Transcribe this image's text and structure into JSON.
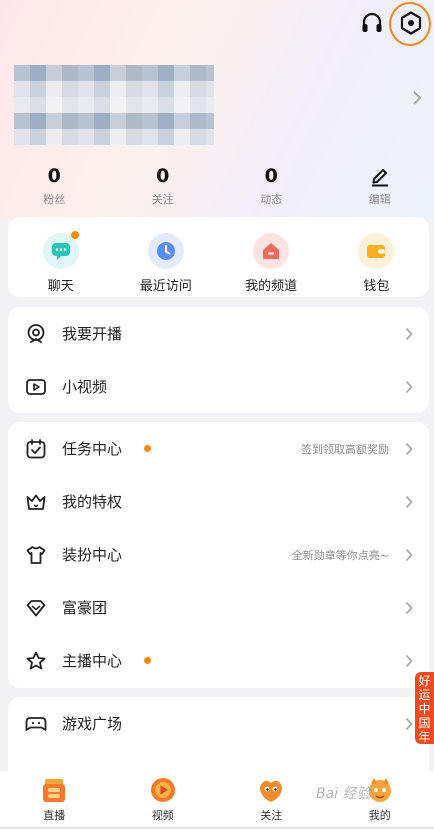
{
  "stats": [
    {
      "value": "0",
      "label": "粉丝"
    },
    {
      "value": "0",
      "label": "关注"
    },
    {
      "value": "0",
      "label": "动态"
    },
    {
      "label": "编辑"
    }
  ],
  "quick": [
    {
      "label": "聊天"
    },
    {
      "label": "最近访问"
    },
    {
      "label": "我的频道"
    },
    {
      "label": "钱包"
    }
  ],
  "menu1": [
    {
      "label": "我要开播"
    },
    {
      "label": "小视频"
    }
  ],
  "menu2": [
    {
      "label": "任务中心",
      "hint": "签到领取高额奖励"
    },
    {
      "label": "我的特权"
    },
    {
      "label": "装扮中心",
      "hint": "全新勋章等你点亮~"
    },
    {
      "label": "富豪团"
    },
    {
      "label": "主播中心"
    }
  ],
  "menu3": [
    {
      "label": "游戏广场"
    }
  ],
  "promo": {
    "text": "好运中国年"
  },
  "tabs": [
    {
      "label": "直播"
    },
    {
      "label": "视频"
    },
    {
      "label": "关注"
    },
    {
      "label": "我的"
    }
  ],
  "watermark": "Bai 经验",
  "colors": {
    "accent": "#ff8a00",
    "highlight": "#f08a1c",
    "promo": "#f04a20"
  }
}
